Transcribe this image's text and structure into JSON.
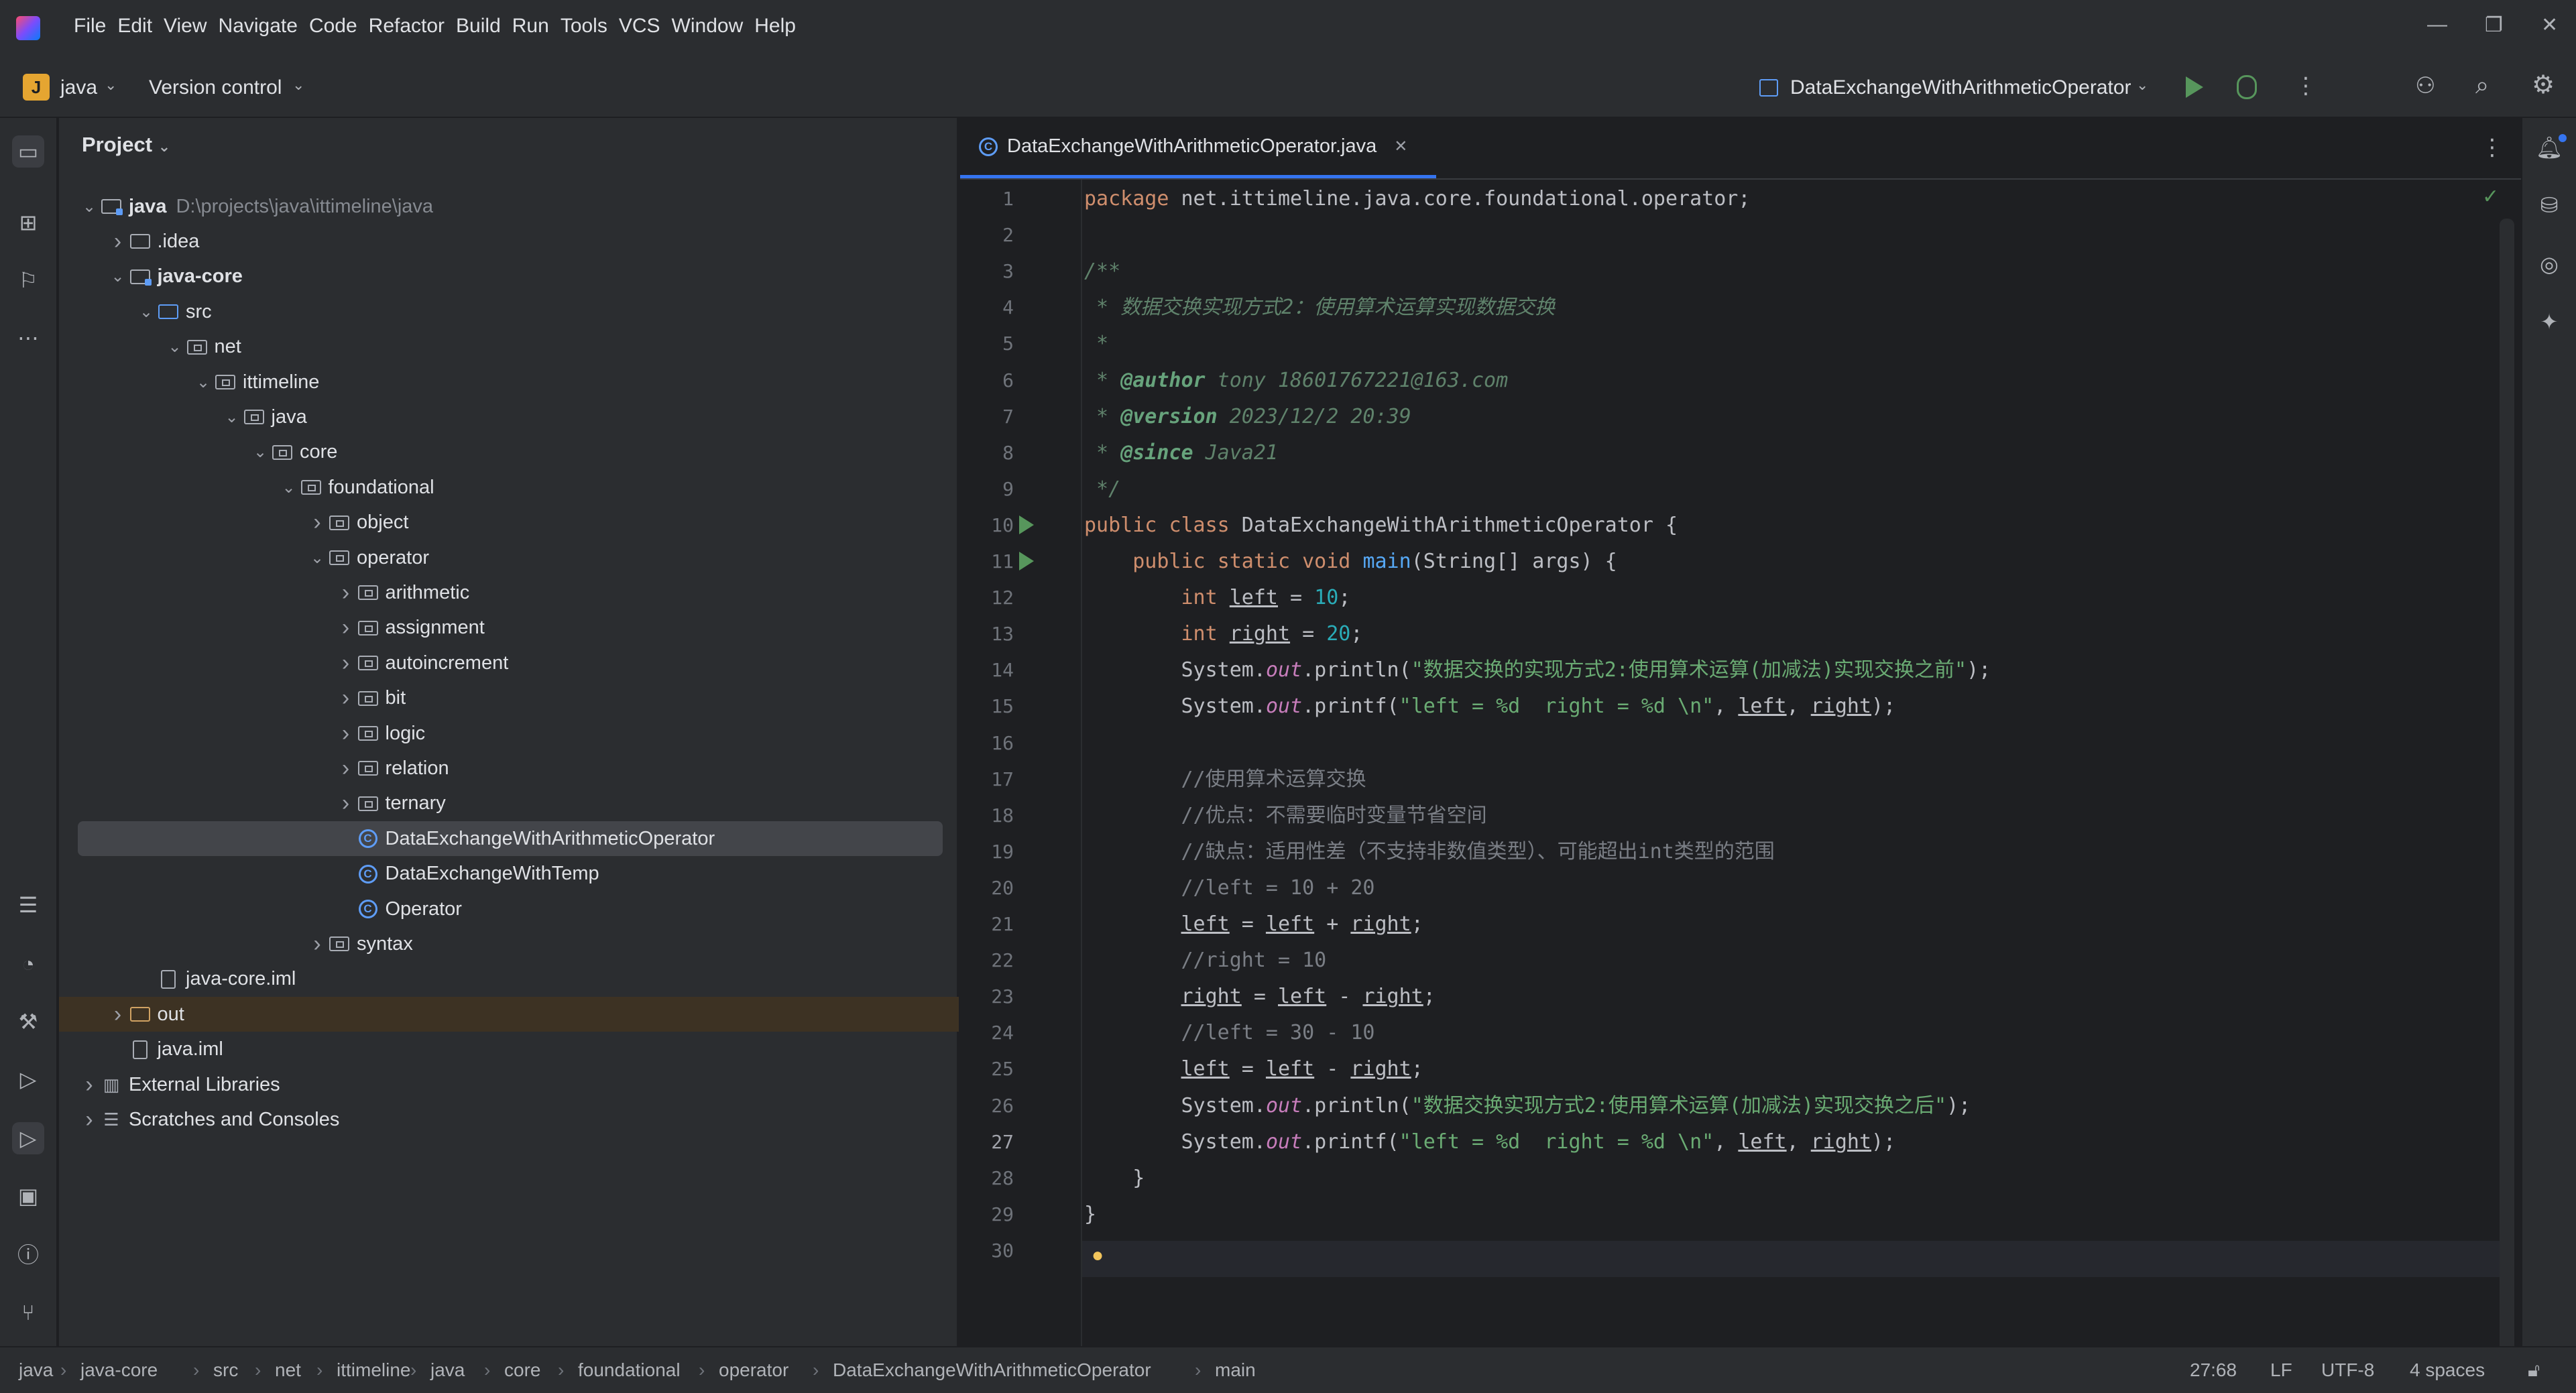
{
  "app": {
    "logo": "intellij-logo"
  },
  "menu": [
    "File",
    "Edit",
    "View",
    "Navigate",
    "Code",
    "Refactor",
    "Build",
    "Run",
    "Tools",
    "VCS",
    "Window",
    "Help"
  ],
  "toolbar": {
    "project_badge": "J",
    "project_name": "java",
    "vcs": "Version control",
    "run_config": "DataExchangeWithArithmeticOperator"
  },
  "project_panel": {
    "title": "Project",
    "tree": [
      {
        "label": "java",
        "extra": "D:\\projects\\java\\ittimeline\\java",
        "depth": 0,
        "expanded": true,
        "icon": "module-folder",
        "bold": true
      },
      {
        "label": ".idea",
        "depth": 1,
        "expanded": false,
        "icon": "folder"
      },
      {
        "label": "java-core",
        "depth": 1,
        "expanded": true,
        "icon": "module-folder",
        "bold": true
      },
      {
        "label": "src",
        "depth": 2,
        "expanded": true,
        "icon": "source-folder"
      },
      {
        "label": "net",
        "depth": 3,
        "expanded": true,
        "icon": "package"
      },
      {
        "label": "ittimeline",
        "depth": 4,
        "expanded": true,
        "icon": "package"
      },
      {
        "label": "java",
        "depth": 5,
        "expanded": true,
        "icon": "package"
      },
      {
        "label": "core",
        "depth": 6,
        "expanded": true,
        "icon": "package"
      },
      {
        "label": "foundational",
        "depth": 7,
        "expanded": true,
        "icon": "package"
      },
      {
        "label": "object",
        "depth": 8,
        "expanded": false,
        "icon": "package"
      },
      {
        "label": "operator",
        "depth": 8,
        "expanded": true,
        "icon": "package"
      },
      {
        "label": "arithmetic",
        "depth": 9,
        "expanded": false,
        "icon": "package"
      },
      {
        "label": "assignment",
        "depth": 9,
        "expanded": false,
        "icon": "package"
      },
      {
        "label": "autoincrement",
        "depth": 9,
        "expanded": false,
        "icon": "package"
      },
      {
        "label": "bit",
        "depth": 9,
        "expanded": false,
        "icon": "package"
      },
      {
        "label": "logic",
        "depth": 9,
        "expanded": false,
        "icon": "package"
      },
      {
        "label": "relation",
        "depth": 9,
        "expanded": false,
        "icon": "package"
      },
      {
        "label": "ternary",
        "depth": 9,
        "expanded": false,
        "icon": "package"
      },
      {
        "label": "DataExchangeWithArithmeticOperator",
        "depth": 9,
        "icon": "class",
        "selected": true
      },
      {
        "label": "DataExchangeWithTemp",
        "depth": 9,
        "icon": "class"
      },
      {
        "label": "Operator",
        "depth": 9,
        "icon": "class"
      },
      {
        "label": "syntax",
        "depth": 8,
        "expanded": false,
        "icon": "package"
      },
      {
        "label": "java-core.iml",
        "depth": 2,
        "icon": "file"
      },
      {
        "label": "out",
        "depth": 1,
        "expanded": false,
        "icon": "out-folder",
        "excluded": true
      },
      {
        "label": "java.iml",
        "depth": 1,
        "icon": "file"
      },
      {
        "label": "External Libraries",
        "depth": 0,
        "expanded": false,
        "icon": "library"
      },
      {
        "label": "Scratches and Consoles",
        "depth": 0,
        "expanded": false,
        "icon": "scratches"
      }
    ]
  },
  "editor": {
    "tab_title": "DataExchangeWithArithmeticOperator.java",
    "current_line": 27,
    "line_numbers": [
      "1",
      "2",
      "3",
      "4",
      "5",
      "6",
      "7",
      "8",
      "9",
      "10",
      "11",
      "12",
      "13",
      "14",
      "15",
      "16",
      "17",
      "18",
      "19",
      "20",
      "21",
      "22",
      "23",
      "24",
      "25",
      "26",
      "27",
      "28",
      "29",
      "30"
    ],
    "code": [
      "package net.ittimeline.java.core.foundational.operator;",
      "",
      "/**",
      " * 数据交换实现方式2：使用算术运算实现数据交换",
      " *",
      " * @author tony 18601767221@163.com",
      " * @version 2023/12/2 20:39",
      " * @since Java21",
      " */",
      "public class DataExchangeWithArithmeticOperator {",
      "    public static void main(String[] args) {",
      "        int left = 10;",
      "        int right = 20;",
      "        System.out.println(\"数据交换的实现方式2:使用算术运算(加减法)实现交换之前\");",
      "        System.out.printf(\"left = %d  right = %d \\n\", left, right);",
      "",
      "        //使用算术运算交换",
      "        //优点：不需要临时变量节省空间",
      "        //缺点：适用性差（不支持非数值类型）、可能超出int类型的范围",
      "        //left = 10 + 20",
      "        left = left + right;",
      "        //right = 10",
      "        right = left - right;",
      "        //left = 30 - 10",
      "        left = left - right;",
      "        System.out.println(\"数据交换实现方式2:使用算术运算(加减法)实现交换之后\");",
      "        System.out.printf(\"left = %d  right = %d \\n\", left, right);",
      "    }",
      "}",
      ""
    ]
  },
  "statusbar": {
    "breadcrumbs": [
      "java",
      "java-core",
      "src",
      "net",
      "ittimeline",
      "java",
      "core",
      "foundational",
      "operator",
      "DataExchangeWithArithmeticOperator",
      "main"
    ],
    "position": "27:68",
    "line_sep": "LF",
    "encoding": "UTF-8",
    "indent": "4 spaces"
  },
  "colors": {
    "accent": "#3574f0",
    "run_green": "#57965c",
    "bg": "#1e1f22",
    "panel": "#2b2d30"
  }
}
